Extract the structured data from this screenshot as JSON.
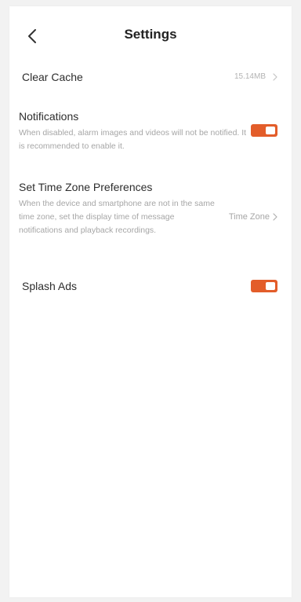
{
  "header": {
    "title": "Settings",
    "back_icon": "chevron-left-icon"
  },
  "settings": {
    "clear_cache": {
      "label": "Clear Cache",
      "value": "15.14MB",
      "chevron_icon": "chevron-right-icon"
    },
    "notifications": {
      "label": "Notifications",
      "description": "When disabled, alarm images and videos will not be notified. It is recommended to enable it.",
      "enabled": true
    },
    "time_zone": {
      "label": "Set Time Zone Preferences",
      "description": "When the device and smartphone are not in the same time zone, set the display time of message notifications and playback recordings.",
      "value": "Time Zone",
      "chevron_icon": "chevron-right-icon"
    },
    "splash_ads": {
      "label": "Splash Ads",
      "enabled": true
    }
  },
  "colors": {
    "accent": "#e35d2a",
    "text_primary": "#2d2d2d",
    "text_secondary": "#a6a6a6"
  }
}
